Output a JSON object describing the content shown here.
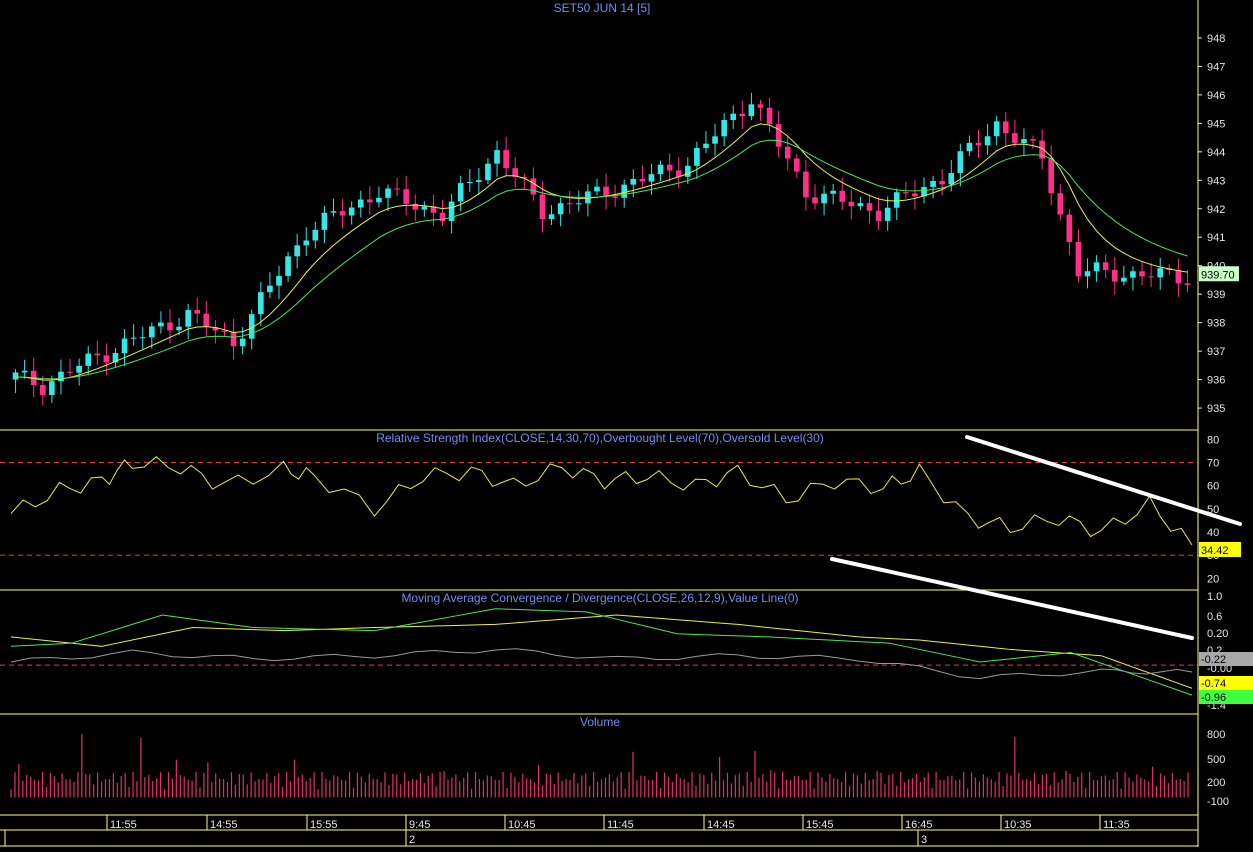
{
  "chart_title": "SET50 JUN 14   [5]",
  "colors": {
    "background": "#000000",
    "up_candle": "#35e6e6",
    "down_candle": "#ff2e8a",
    "ma_fast": "#e8f04a",
    "ma_slow": "#4ee35a",
    "rsi_line": "#e8e84a",
    "panel_title": "#6f8ff0",
    "axis_text": "#e6e6e6",
    "divider": "#ffff7a",
    "level_line": "#e04040",
    "volume_bar": "#e0306a",
    "trend_line": "#ffffff"
  },
  "chart_data": [
    {
      "panel": "price",
      "type": "candlestick",
      "title": "SET50 JUN 14   [5]",
      "ylim": [
        934.3,
        948.7
      ],
      "yticks": [
        935,
        936,
        937,
        938,
        939,
        940,
        941,
        942,
        943,
        944,
        945,
        946,
        947,
        948
      ],
      "last_value": "939.70",
      "segments": [
        {
          "start": 936.2,
          "end": 935.8,
          "n": 4
        },
        {
          "start": 935.8,
          "end": 936.8,
          "n": 6
        },
        {
          "start": 936.8,
          "end": 938.3,
          "n": 10
        },
        {
          "start": 938.3,
          "end": 937.3,
          "n": 5
        },
        {
          "start": 937.3,
          "end": 941.2,
          "n": 8
        },
        {
          "start": 941.2,
          "end": 942.6,
          "n": 8
        },
        {
          "start": 942.6,
          "end": 941.8,
          "n": 7
        },
        {
          "start": 941.8,
          "end": 944.0,
          "n": 6
        },
        {
          "start": 944.0,
          "end": 941.9,
          "n": 5
        },
        {
          "start": 941.9,
          "end": 942.7,
          "n": 8
        },
        {
          "start": 942.7,
          "end": 943.6,
          "n": 8
        },
        {
          "start": 943.6,
          "end": 945.9,
          "n": 7
        },
        {
          "start": 945.9,
          "end": 942.6,
          "n": 6
        },
        {
          "start": 942.6,
          "end": 941.9,
          "n": 8
        },
        {
          "start": 941.9,
          "end": 943.1,
          "n": 7
        },
        {
          "start": 943.1,
          "end": 945.0,
          "n": 6
        },
        {
          "start": 945.0,
          "end": 943.8,
          "n": 5
        },
        {
          "start": 943.8,
          "end": 939.8,
          "n": 4
        },
        {
          "start": 939.8,
          "end": 939.6,
          "n": 12
        }
      ]
    },
    {
      "panel": "rsi",
      "type": "line",
      "title": "Relative Strength Index(CLOSE,14,30,70),Overbought Level(70),Oversold Level(30)",
      "ylim": [
        15,
        84
      ],
      "yticks": [
        20,
        30,
        40,
        50,
        60,
        70,
        80
      ],
      "levels": [
        70,
        30
      ],
      "last_value": "34.42",
      "x": [
        0,
        8,
        15,
        20,
        28,
        35,
        45,
        50,
        60,
        68,
        76,
        83,
        91,
        98,
        105,
        113,
        120,
        128,
        136,
        144,
        150,
        158,
        165,
        173,
        180,
        188,
        195
      ],
      "y": [
        48,
        58,
        62,
        70,
        68,
        60,
        67,
        64,
        50,
        64,
        66,
        60,
        68,
        62,
        64,
        60,
        66,
        54,
        62,
        59,
        66,
        46,
        42,
        46,
        40,
        52,
        34.42
      ]
    },
    {
      "panel": "macd",
      "type": "line",
      "title": "Moving Average Convergence / Divergence(CLOSE,26,12,9),Value Line(0)",
      "ylim": [
        -1.5,
        2.4
      ],
      "yticks": [
        -1.4,
        -0.6,
        0.2,
        0.6,
        1.0
      ],
      "level_value": 0,
      "tick_labels": [
        "1.0",
        "0.6",
        "0.20",
        "0.2",
        "-0.00",
        "-1.4"
      ],
      "last_values": [
        "-0.22",
        "-0.74",
        "-0.96"
      ],
      "series": [
        {
          "x": [
            0,
            15,
            30,
            45,
            60,
            80,
            100,
            120,
            140,
            150,
            165,
            180,
            195
          ],
          "y": [
            0.9,
            0.6,
            1.2,
            1.1,
            1.2,
            1.3,
            1.6,
            1.3,
            0.9,
            0.8,
            0.5,
            0.3,
            -0.74
          ]
        },
        {
          "x": [
            0,
            10,
            25,
            40,
            60,
            80,
            95,
            110,
            125,
            145,
            160,
            175,
            195
          ],
          "y": [
            0.6,
            0.7,
            1.6,
            1.2,
            1.1,
            1.8,
            1.7,
            1.0,
            0.9,
            0.7,
            0.1,
            0.4,
            -0.96
          ]
        },
        {
          "x": [
            0,
            20,
            40,
            60,
            80,
            100,
            120,
            140,
            160,
            180,
            195
          ],
          "y": [
            0.1,
            0.4,
            0.2,
            0.3,
            0.5,
            0.2,
            0.3,
            0.2,
            -0.4,
            -0.2,
            -0.22
          ]
        }
      ]
    },
    {
      "panel": "volume",
      "type": "bar",
      "title": "Volume",
      "ylim": [
        -200,
        950
      ],
      "yticks": [
        -100,
        200,
        500,
        800
      ],
      "tick_labels": [
        "-100",
        "200",
        "500",
        "800"
      ],
      "n": 200,
      "base": 170,
      "spikes": [
        [
          2,
          380
        ],
        [
          18,
          720
        ],
        [
          33,
          680
        ],
        [
          42,
          430
        ],
        [
          50,
          400
        ],
        [
          72,
          430
        ],
        [
          110,
          300
        ],
        [
          134,
          370
        ],
        [
          158,
          520
        ],
        [
          180,
          460
        ],
        [
          189,
          530
        ],
        [
          193,
          310
        ],
        [
          220,
          300
        ],
        [
          255,
          690
        ],
        [
          268,
          300
        ],
        [
          290,
          350
        ]
      ]
    }
  ],
  "time_axis": {
    "labels": [
      "11:55",
      "14:55",
      "15:55",
      "9:45",
      "10:45",
      "11:45",
      "14:45",
      "15:45",
      "16:45",
      "10:35",
      "11:35"
    ],
    "day_labels": [
      "2",
      "3"
    ]
  }
}
